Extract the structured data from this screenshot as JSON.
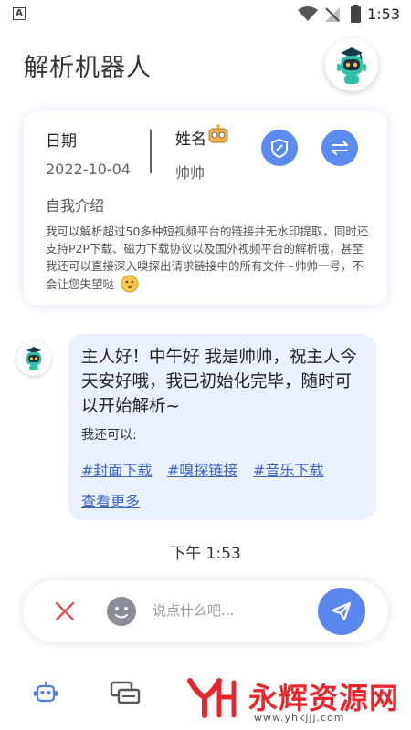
{
  "status_bar": {
    "app_badge": "A",
    "time": "1:53"
  },
  "header": {
    "title": "解析机器人"
  },
  "profile": {
    "date_label": "日期",
    "date_value": "2022-10-04",
    "name_label": "姓名",
    "name_value": "帅帅",
    "intro_label": "自我介绍",
    "intro_text": "我可以解析超过50多种短视频平台的链接并无水印提取，同时还支持P2P下载、磁力下载协议以及国外视频平台的解析哦，甚至我还可以直接深入嗅探出请求链接中的所有文件~帅帅一号，不会让您失望哒"
  },
  "chat": {
    "greeting": "主人好！中午好 我是帅帅，祝主人今天安好哦，我已初始化完毕，随时可以开始解析~",
    "can_label": "我还可以:",
    "links": [
      "#封面下载",
      "#嗅探链接",
      "#音乐下载"
    ],
    "more_label": "查看更多",
    "timestamp": "下午 1:53"
  },
  "input": {
    "placeholder": "说点什么吧..."
  },
  "watermark": {
    "text": "永辉资源网",
    "url": "www.yhkjjj.com"
  },
  "colors": {
    "accent": "#5b8bf0",
    "bubble": "#eaf0fd",
    "link": "#3a66c7",
    "close": "#e05555",
    "watermark": "#e8262b"
  }
}
